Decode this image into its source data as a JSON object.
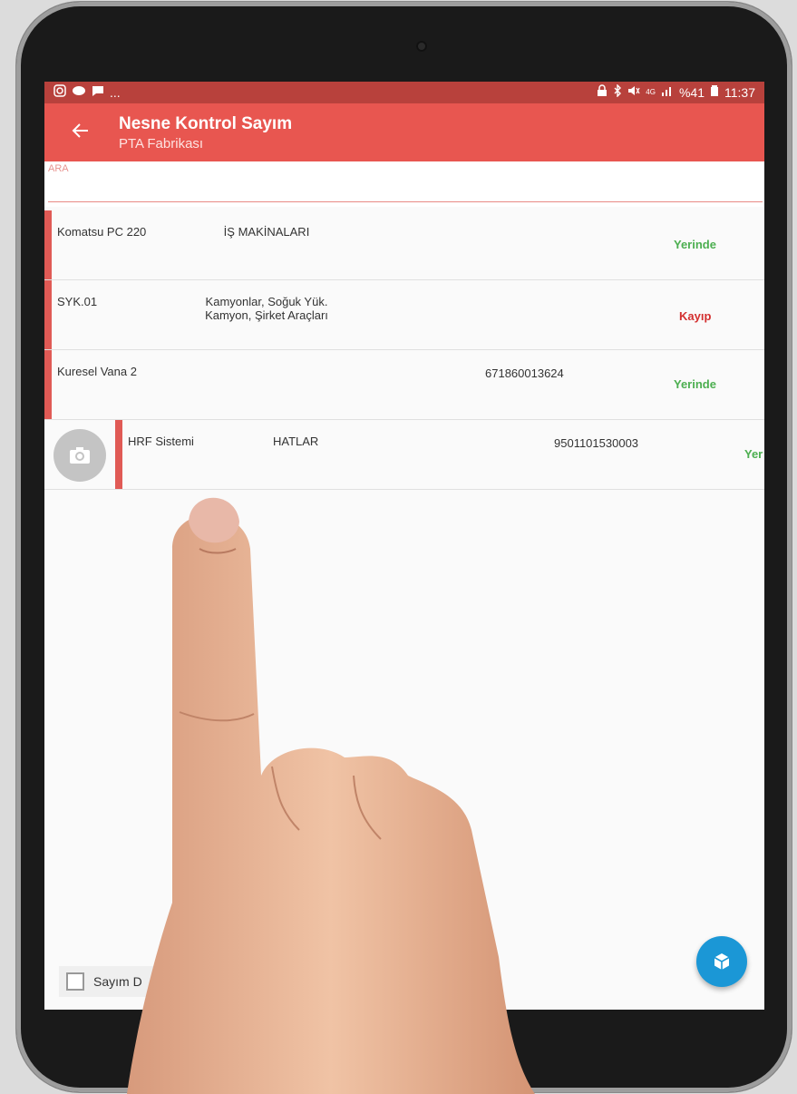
{
  "status_bar": {
    "left_icons": [
      "instagram-icon",
      "message-icon",
      "chat-icon"
    ],
    "left_more": "...",
    "right_text": "%41",
    "time": "11:37",
    "network": "4G"
  },
  "app_bar": {
    "title": "Nesne Kontrol Sayım",
    "subtitle": "PTA Fabrikası"
  },
  "search": {
    "label": "ARA",
    "value": ""
  },
  "items": [
    {
      "name": "Komatsu PC 220",
      "category": "İŞ MAKİNALARI",
      "code": "",
      "status": "Yerinde"
    },
    {
      "name": "SYK.01",
      "category": "Kamyonlar, Soğuk Yük. Kamyon, Şirket Araçları",
      "code": "",
      "status": "Kayıp"
    },
    {
      "name": "Kuresel Vana 2",
      "category": "",
      "code": "671860013624",
      "status": "Yerinde"
    },
    {
      "name": "HRF Sistemi",
      "category": "HATLAR",
      "code": "9501101530003",
      "status": "Yer"
    }
  ],
  "footer": {
    "checkbox_label": "Sayım D"
  },
  "colors": {
    "primary": "#e85650",
    "status_ok": "#4caf50",
    "status_lost": "#d32f2f",
    "fab": "#1b97d6"
  }
}
